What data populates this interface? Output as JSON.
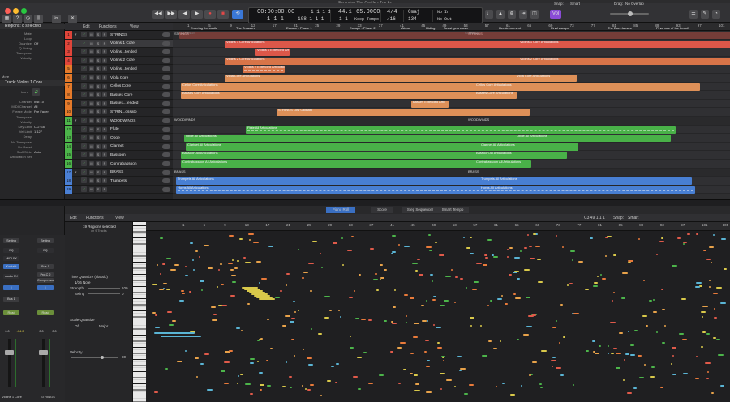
{
  "window": {
    "title": "Exploring The Castle - Tracks"
  },
  "toolbar": {
    "lcd": {
      "time": "00:00:00.00",
      "bars": "1 1 1",
      "tempo": "65.0000",
      "tempo_mode": "Keep Tempo",
      "bpm": "44.1",
      "bar_pos": "1 1",
      "sub": "1 1 1 1",
      "sub2": "108 1 1 1",
      "meter": "4/4",
      "division": "/16",
      "key": "Cmaj",
      "key_num": "134",
      "in": "No In",
      "out": "No Out"
    },
    "vol_label": "Vol"
  },
  "inspector": {
    "region_header": "Regions: 8 selected",
    "region_rows": [
      [
        "Mute:",
        ""
      ],
      [
        "Loop:",
        ""
      ],
      [
        "Quantize:",
        "Off"
      ],
      [
        "Q-Swing:",
        ""
      ],
      [
        "Transpose:",
        ""
      ],
      [
        "Velocity:",
        ""
      ]
    ],
    "more": "More",
    "track_header": "Track: Violins 1 Core",
    "icon_label": "Icon:",
    "track_rows": [
      [
        "Channel:",
        "Inst 10"
      ],
      [
        "MIDI Channel:",
        "All"
      ],
      [
        "Freeze Mode:",
        "Pre Fader"
      ],
      [
        "Transpose:",
        ""
      ],
      [
        "Velocity:",
        ""
      ],
      [
        "Key Limit:",
        "C-2  G8"
      ],
      [
        "Vel Limit:",
        "1  127"
      ],
      [
        "Delay:",
        ""
      ],
      [
        "No Transpose:",
        ""
      ],
      [
        "No Reset:",
        ""
      ],
      [
        "Staff Style:",
        "Auto"
      ],
      [
        "Articulation Set:",
        ""
      ]
    ]
  },
  "mixer": {
    "setting": "Setting",
    "eq": "EQ",
    "midi_fx": "MIDI FX",
    "kontakt": "Kontakt",
    "audio_fx": "Audio FX",
    "bus1": "Bus 1",
    "proc2": "Pro-C 2",
    "compressor": "Compressor",
    "read": "Read",
    "val1": "0.0",
    "val2": "-14.0",
    "val3": "0.0",
    "val4": "0.0",
    "ch1": "Violins 1 Core",
    "ch2": "STRINGS",
    "s": "S",
    "m": "M",
    "r": "R",
    "i": "I"
  },
  "track_list": {
    "menu_edit": "Edit",
    "menu_functions": "Functions",
    "menu_view": "View",
    "tracks": [
      {
        "n": "1",
        "name": "STRINGS",
        "color": "#e0453a"
      },
      {
        "n": "2",
        "name": "Violins 1 Core",
        "color": "#e0453a"
      },
      {
        "n": "3",
        "name": "Violins...tended",
        "color": "#e0453a"
      },
      {
        "n": "4",
        "name": "Violins 2 Core",
        "color": "#e0453a"
      },
      {
        "n": "5",
        "name": "Violins...tended",
        "color": "#e57a2a"
      },
      {
        "n": "6",
        "name": "Viola Core",
        "color": "#e57a2a"
      },
      {
        "n": "7",
        "name": "Cellos Core",
        "color": "#e57a2a"
      },
      {
        "n": "8",
        "name": "Basses Core",
        "color": "#e57a2a"
      },
      {
        "n": "9",
        "name": "Basses...tended",
        "color": "#e57a2a"
      },
      {
        "n": "10",
        "name": "STRIN...ossato",
        "color": "#e57a2a"
      },
      {
        "n": "11",
        "name": "WOODWINDS",
        "color": "#4cb44a"
      },
      {
        "n": "12",
        "name": "Flute",
        "color": "#4cb44a"
      },
      {
        "n": "13",
        "name": "Oboe",
        "color": "#4cb44a"
      },
      {
        "n": "14",
        "name": "Clarinet",
        "color": "#4cb44a"
      },
      {
        "n": "15",
        "name": "Bassoon",
        "color": "#4cb44a"
      },
      {
        "n": "16",
        "name": "Contrabassoon",
        "color": "#4cb44a"
      },
      {
        "n": "17",
        "name": "BRASS",
        "color": "#4a7fd4"
      },
      {
        "n": "18",
        "name": "Trumpets",
        "color": "#4a7fd4"
      },
      {
        "n": "19",
        "name": "",
        "color": "#4a7fd4"
      }
    ]
  },
  "arrange": {
    "snap_label": "Snap:",
    "snap": "Smart",
    "drag_label": "Drag:",
    "drag": "No Overlap",
    "bars": [
      "1",
      "5",
      "9",
      "13",
      "17",
      "21",
      "25",
      "29",
      "33",
      "37",
      "41",
      "45",
      "49",
      "53",
      "57",
      "61",
      "65",
      "69",
      "73",
      "77",
      "81",
      "85",
      "89",
      "93",
      "97",
      "101"
    ],
    "markers": [
      "Entering the castle",
      "The Treasure",
      "Escape - Phase 1",
      "Escape - Phase 2",
      "Abyss",
      "Hiding",
      "Beast gets closer",
      "Heroic moment",
      "Final escape",
      "The Esc...lapses",
      "Final roar of the beast!"
    ],
    "section_labels": [
      "STRINGS",
      "WOODWINDS",
      "BRASS"
    ],
    "regions": [
      {
        "row": 0,
        "label": "STRINGS",
        "label2": "STRINGS",
        "color": "#e65a4b"
      },
      {
        "row": 1,
        "label": "Violins 1 Core Articulations",
        "label2": "Violins 1 Core Articulations",
        "color": "#e65a4b"
      },
      {
        "row": 2,
        "label": "Violins 1 Extended Art",
        "color": "#e65a4b"
      },
      {
        "row": 3,
        "label": "Violins 2 Core Articulations",
        "label2": "Violins 2 Core Articulations",
        "color": "#e2784a"
      },
      {
        "row": 4,
        "label": "Violins 2 Extended Articulation",
        "color": "#e2784a"
      },
      {
        "row": 5,
        "label": "Viola Core Articulations",
        "label2": "Viola Core Articulations",
        "color": "#e8965a"
      },
      {
        "row": 6,
        "label": "Cellos Core Articulations",
        "label2": "Cellos Core Articulations",
        "color": "#e8965a"
      },
      {
        "row": 7,
        "label": "Basses Core Articulations",
        "label2": "Basses Core Articulations",
        "color": "#e8965a"
      },
      {
        "row": 8,
        "label": "Basses Extended Artic",
        "color": "#e8965a"
      },
      {
        "row": 9,
        "label": "STRINGS Low Ostinato",
        "color": "#e8965a"
      },
      {
        "row": 11,
        "label": "Flute All Articulations",
        "color": "#4bb84a"
      },
      {
        "row": 12,
        "label": "Oboe All Articulations",
        "label2": "Oboe All Articulations",
        "color": "#4bb84a"
      },
      {
        "row": 13,
        "label": "Clarinet All Articulations",
        "label2": "Clarinet All Articulations",
        "color": "#4bb84a"
      },
      {
        "row": 14,
        "label": "Bassoon All Articulations",
        "label2": "Bassoon All Articulations",
        "color": "#4bb84a"
      },
      {
        "row": 15,
        "label": "Contrabassoon All Articulations",
        "label2": "Contrabassoon All Articulations",
        "color": "#4bb84a"
      },
      {
        "row": 17,
        "label": "Trumpets All Articulations",
        "label2": "Trumpets All Articulations",
        "color": "#4a84dc"
      },
      {
        "row": 18,
        "label": "Horns All Articulations",
        "label2": "Horns All Articulations",
        "color": "#4a84dc"
      }
    ]
  },
  "editor_tabs": [
    "Piano Roll",
    "Score",
    "Step Sequencer",
    "Smart Tempo"
  ],
  "piano_roll": {
    "menu_edit": "Edit",
    "menu_functions": "Functions",
    "menu_view": "View",
    "position": "C3  49 1 1 1",
    "snap_label": "Snap:",
    "snap": "Smart",
    "selected": "19 Regions selected",
    "selected_sub": "on 9 Tracks",
    "time_quantize": "Time Quantize (classic)",
    "time_quantize_val": "1/16 Note",
    "strength": "Strength",
    "strength_val": "100",
    "swing": "Swing",
    "swing_val": "0",
    "scale_quantize": "Scale Quantize",
    "sq_off": "Off",
    "sq_major": "Major",
    "velocity": "Velocity",
    "velocity_val": "80",
    "bars": [
      "1",
      "5",
      "9",
      "13",
      "17",
      "21",
      "25",
      "29",
      "33",
      "37",
      "41",
      "45",
      "49",
      "53",
      "57",
      "61",
      "65",
      "69",
      "73",
      "77",
      "81",
      "85",
      "89",
      "93",
      "97",
      "101",
      "105"
    ],
    "key_label": "C3"
  }
}
